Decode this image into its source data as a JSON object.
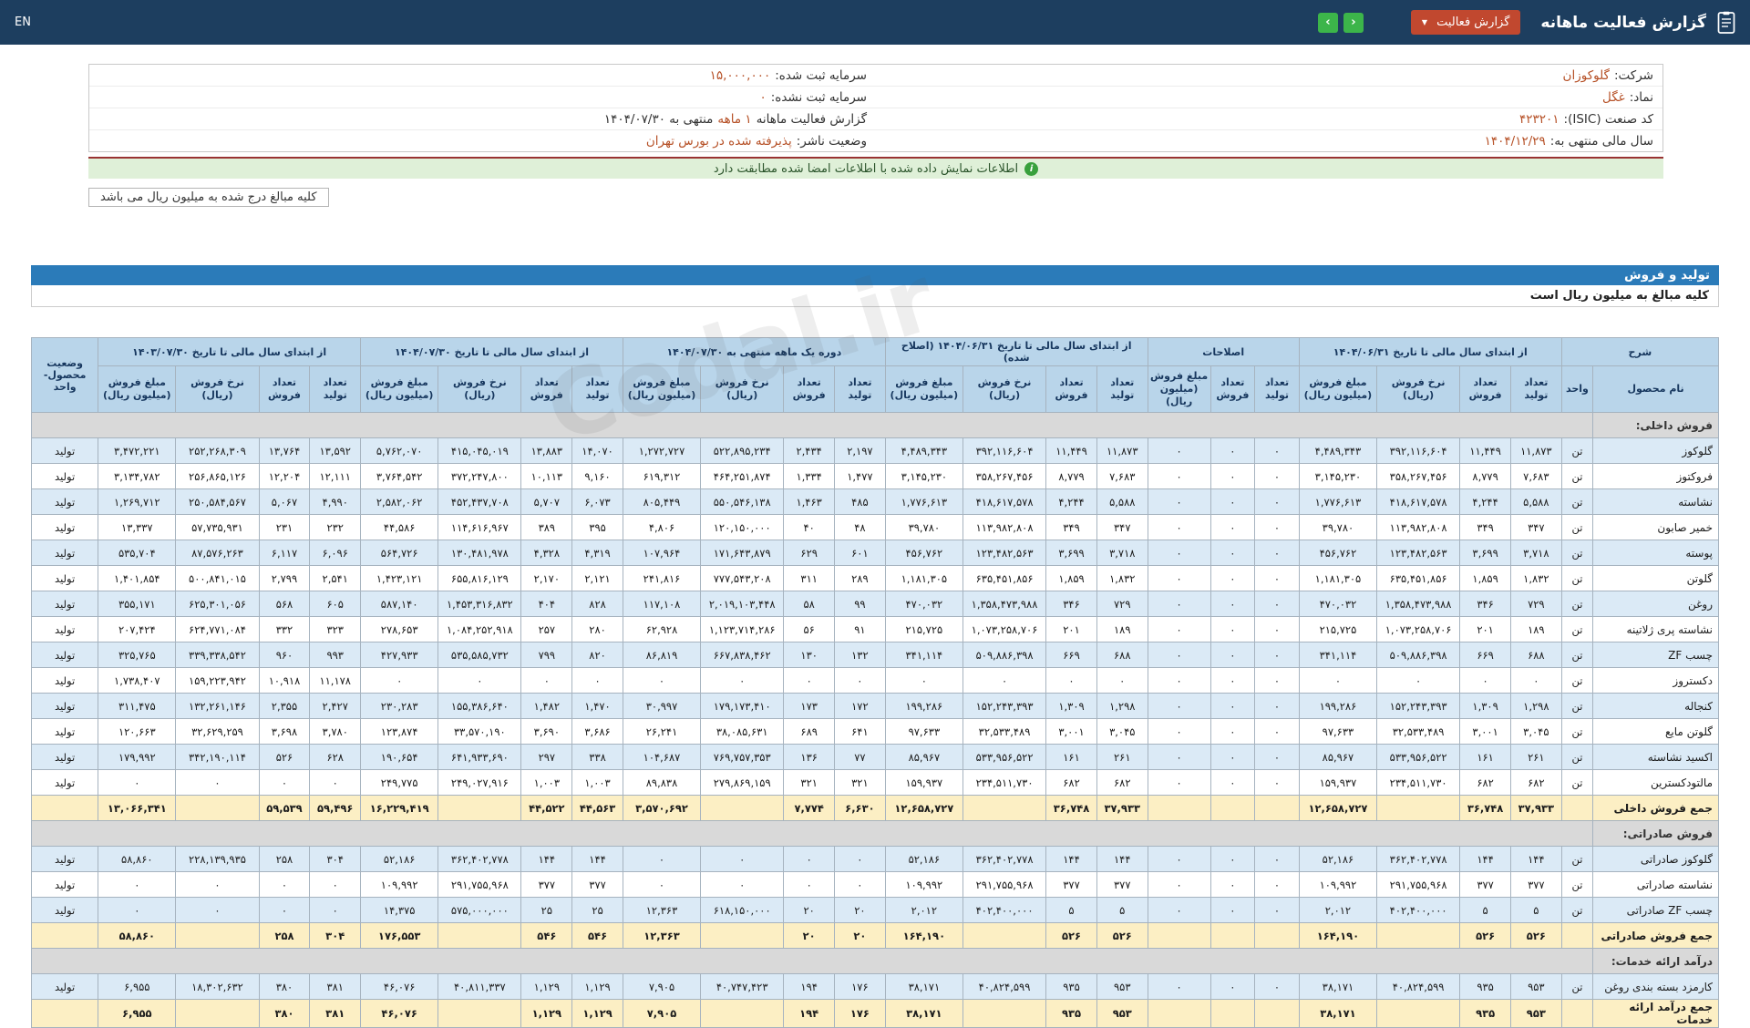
{
  "topbar": {
    "title": "گزارش فعالیت ماهانه",
    "dropdown_label": "گزارش فعالیت",
    "prev_glyph": "‹",
    "next_glyph": "›",
    "en_label": "EN"
  },
  "info": {
    "right_rows": [
      {
        "label": "شرکت:",
        "value": "گلوکوزان",
        "link": true
      },
      {
        "label": "نماد:",
        "value": "غگل",
        "link": true
      },
      {
        "label": "کد صنعت (ISIC):",
        "value": "۴۲۳۲۰۱",
        "link": false
      },
      {
        "label": "سال مالی منتهی به:",
        "value": "۱۴۰۴/۱۲/۲۹",
        "link": false
      }
    ],
    "left_rows": [
      {
        "label": "سرمایه ثبت شده:",
        "value": "۱۵,۰۰۰,۰۰۰",
        "link": false
      },
      {
        "label": "سرمایه ثبت نشده:",
        "value": "۰",
        "link": false
      },
      {
        "label": "گزارش فعالیت ماهانه",
        "value": "۱ ماهه",
        "suffix": "منتهی به ۱۴۰۴/۰۷/۳۰",
        "link": false
      },
      {
        "label": "وضعیت ناشر:",
        "value": "پذیرفته شده در بورس تهران",
        "link": false
      }
    ]
  },
  "banner": {
    "text": "اطلاعات نمایش داده شده با اطلاعات امضا شده مطابقت دارد"
  },
  "notes": {
    "pill": "کلیه مبالغ درج شده به میلیون ریال می باشد"
  },
  "section": {
    "title": "تولید و فروش",
    "subtitle": "کلیه مبالغ به میلیون ریال است"
  },
  "watermark": "Codal.ir",
  "colors": {
    "topbar": "#1d3e5f",
    "dropdown": "#c1482f",
    "nav_button": "#3cb54a",
    "link": "#b65127",
    "banner_bg": "#dff0d8",
    "section_bar": "#2b7bb9",
    "header_cell": "#b9d5ea",
    "row_alt": "#dbeaf6",
    "sum_row": "#fcefc4",
    "section_row": "#d9d9d9"
  },
  "table": {
    "desc_header": "شرح",
    "name_header": "نام محصول",
    "unit_header": "واحد",
    "status_header": "وضعیت محصول-واحد",
    "sub_headers": {
      "qty_prod": "تعداد تولید",
      "qty_sold": "تعداد فروش",
      "rate": "نرخ فروش (ریال)",
      "amount": "مبلغ فروش (میلیون ریال)"
    },
    "groups": [
      {
        "key": "g1",
        "label": "از ابتدای سال مالی تا تاریخ ۱۴۰۴/۰۶/۳۱",
        "cols": [
          "qty_prod",
          "qty_sold",
          "rate",
          "amount"
        ]
      },
      {
        "key": "g2",
        "label": "اصلاحات",
        "cols": [
          "qty_prod",
          "qty_sold",
          "amount"
        ]
      },
      {
        "key": "g3",
        "label": "از ابتدای سال مالی تا تاریخ ۱۴۰۴/۰۶/۳۱ (اصلاح شده)",
        "cols": [
          "qty_prod",
          "qty_sold",
          "rate",
          "amount"
        ]
      },
      {
        "key": "g4",
        "label": "دوره یک ماهه منتهی به ۱۴۰۴/۰۷/۳۰",
        "cols": [
          "qty_prod",
          "qty_sold",
          "rate",
          "amount"
        ]
      },
      {
        "key": "g5",
        "label": "از ابتدای سال مالی تا تاریخ ۱۴۰۴/۰۷/۳۰",
        "cols": [
          "qty_prod",
          "qty_sold",
          "rate",
          "amount"
        ]
      },
      {
        "key": "g6",
        "label": "از ابتدای سال مالی تا تاریخ ۱۴۰۳/۰۷/۳۰",
        "cols": [
          "qty_prod",
          "qty_sold",
          "rate",
          "amount"
        ]
      }
    ],
    "rows": [
      {
        "type": "section",
        "name": "فروش داخلی:"
      },
      {
        "type": "product",
        "name": "گلوکوز",
        "unit": "تن",
        "g1": [
          "۱۱,۸۷۳",
          "۱۱,۴۴۹",
          "۳۹۲,۱۱۶,۶۰۴",
          "۴,۴۸۹,۳۴۳"
        ],
        "g2": [
          "۰",
          "۰",
          "۰"
        ],
        "g3": [
          "۱۱,۸۷۳",
          "۱۱,۴۴۹",
          "۳۹۲,۱۱۶,۶۰۴",
          "۴,۴۸۹,۳۴۳"
        ],
        "g4": [
          "۲,۱۹۷",
          "۲,۴۳۴",
          "۵۲۲,۸۹۵,۲۳۴",
          "۱,۲۷۲,۷۲۷"
        ],
        "g5": [
          "۱۴,۰۷۰",
          "۱۳,۸۸۳",
          "۴۱۵,۰۴۵,۰۱۹",
          "۵,۷۶۲,۰۷۰"
        ],
        "g6": [
          "۱۳,۵۹۲",
          "۱۳,۷۶۴",
          "۲۵۲,۲۶۸,۳۰۹",
          "۳,۴۷۲,۲۲۱"
        ],
        "status": "تولید"
      },
      {
        "type": "product",
        "name": "فروکتوز",
        "unit": "تن",
        "g1": [
          "۷,۶۸۳",
          "۸,۷۷۹",
          "۳۵۸,۲۶۷,۴۵۶",
          "۳,۱۴۵,۲۳۰"
        ],
        "g2": [
          "۰",
          "۰",
          "۰"
        ],
        "g3": [
          "۷,۶۸۳",
          "۸,۷۷۹",
          "۳۵۸,۲۶۷,۴۵۶",
          "۳,۱۴۵,۲۳۰"
        ],
        "g4": [
          "۱,۴۷۷",
          "۱,۳۳۴",
          "۴۶۴,۲۵۱,۸۷۴",
          "۶۱۹,۳۱۲"
        ],
        "g5": [
          "۹,۱۶۰",
          "۱۰,۱۱۳",
          "۳۷۲,۲۴۷,۸۰۰",
          "۳,۷۶۴,۵۴۲"
        ],
        "g6": [
          "۱۲,۱۱۱",
          "۱۲,۲۰۴",
          "۲۵۶,۸۶۵,۱۲۶",
          "۳,۱۳۴,۷۸۲"
        ],
        "status": "تولید"
      },
      {
        "type": "product",
        "name": "نشاسته",
        "unit": "تن",
        "g1": [
          "۵,۵۸۸",
          "۴,۲۴۴",
          "۴۱۸,۶۱۷,۵۷۸",
          "۱,۷۷۶,۶۱۳"
        ],
        "g2": [
          "۰",
          "۰",
          "۰"
        ],
        "g3": [
          "۵,۵۸۸",
          "۴,۲۴۴",
          "۴۱۸,۶۱۷,۵۷۸",
          "۱,۷۷۶,۶۱۳"
        ],
        "g4": [
          "۴۸۵",
          "۱,۴۶۳",
          "۵۵۰,۵۴۶,۱۳۸",
          "۸۰۵,۴۴۹"
        ],
        "g5": [
          "۶,۰۷۳",
          "۵,۷۰۷",
          "۴۵۲,۴۳۷,۷۰۸",
          "۲,۵۸۲,۰۶۲"
        ],
        "g6": [
          "۴,۹۹۰",
          "۵,۰۶۷",
          "۲۵۰,۵۸۴,۵۶۷",
          "۱,۲۶۹,۷۱۲"
        ],
        "status": "تولید"
      },
      {
        "type": "product",
        "name": "خمیر صابون",
        "unit": "تن",
        "g1": [
          "۳۴۷",
          "۳۴۹",
          "۱۱۳,۹۸۲,۸۰۸",
          "۳۹,۷۸۰"
        ],
        "g2": [
          "۰",
          "۰",
          "۰"
        ],
        "g3": [
          "۳۴۷",
          "۳۴۹",
          "۱۱۳,۹۸۲,۸۰۸",
          "۳۹,۷۸۰"
        ],
        "g4": [
          "۴۸",
          "۴۰",
          "۱۲۰,۱۵۰,۰۰۰",
          "۴,۸۰۶"
        ],
        "g5": [
          "۳۹۵",
          "۳۸۹",
          "۱۱۴,۶۱۶,۹۶۷",
          "۴۴,۵۸۶"
        ],
        "g6": [
          "۲۳۲",
          "۲۳۱",
          "۵۷,۷۳۵,۹۳۱",
          "۱۳,۳۳۷"
        ],
        "status": "تولید"
      },
      {
        "type": "product",
        "name": "پوسته",
        "unit": "تن",
        "g1": [
          "۳,۷۱۸",
          "۳,۶۹۹",
          "۱۲۳,۴۸۲,۵۶۳",
          "۴۵۶,۷۶۲"
        ],
        "g2": [
          "۰",
          "۰",
          "۰"
        ],
        "g3": [
          "۳,۷۱۸",
          "۳,۶۹۹",
          "۱۲۳,۴۸۲,۵۶۳",
          "۴۵۶,۷۶۲"
        ],
        "g4": [
          "۶۰۱",
          "۶۲۹",
          "۱۷۱,۶۴۳,۸۷۹",
          "۱۰۷,۹۶۴"
        ],
        "g5": [
          "۴,۳۱۹",
          "۴,۳۲۸",
          "۱۳۰,۴۸۱,۹۷۸",
          "۵۶۴,۷۲۶"
        ],
        "g6": [
          "۶,۰۹۶",
          "۶,۱۱۷",
          "۸۷,۵۷۶,۲۶۳",
          "۵۳۵,۷۰۴"
        ],
        "status": "تولید"
      },
      {
        "type": "product",
        "name": "گلوتن",
        "unit": "تن",
        "g1": [
          "۱,۸۳۲",
          "۱,۸۵۹",
          "۶۳۵,۴۵۱,۸۵۶",
          "۱,۱۸۱,۳۰۵"
        ],
        "g2": [
          "۰",
          "۰",
          "۰"
        ],
        "g3": [
          "۱,۸۳۲",
          "۱,۸۵۹",
          "۶۳۵,۴۵۱,۸۵۶",
          "۱,۱۸۱,۳۰۵"
        ],
        "g4": [
          "۲۸۹",
          "۳۱۱",
          "۷۷۷,۵۴۳,۲۰۸",
          "۲۴۱,۸۱۶"
        ],
        "g5": [
          "۲,۱۲۱",
          "۲,۱۷۰",
          "۶۵۵,۸۱۶,۱۲۹",
          "۱,۴۲۳,۱۲۱"
        ],
        "g6": [
          "۲,۵۴۱",
          "۲,۷۹۹",
          "۵۰۰,۸۴۱,۰۱۵",
          "۱,۴۰۱,۸۵۴"
        ],
        "status": "تولید"
      },
      {
        "type": "product",
        "name": "روغن",
        "unit": "تن",
        "g1": [
          "۷۲۹",
          "۳۴۶",
          "۱,۳۵۸,۴۷۳,۹۸۸",
          "۴۷۰,۰۳۲"
        ],
        "g2": [
          "۰",
          "۰",
          "۰"
        ],
        "g3": [
          "۷۲۹",
          "۳۴۶",
          "۱,۳۵۸,۴۷۳,۹۸۸",
          "۴۷۰,۰۳۲"
        ],
        "g4": [
          "۹۹",
          "۵۸",
          "۲,۰۱۹,۱۰۳,۴۴۸",
          "۱۱۷,۱۰۸"
        ],
        "g5": [
          "۸۲۸",
          "۴۰۴",
          "۱,۴۵۳,۳۱۶,۸۳۲",
          "۵۸۷,۱۴۰"
        ],
        "g6": [
          "۶۰۵",
          "۵۶۸",
          "۶۲۵,۳۰۱,۰۵۶",
          "۳۵۵,۱۷۱"
        ],
        "status": "تولید"
      },
      {
        "type": "product",
        "name": "نشاسته پری ژلاتینه",
        "unit": "تن",
        "g1": [
          "۱۸۹",
          "۲۰۱",
          "۱,۰۷۳,۲۵۸,۷۰۶",
          "۲۱۵,۷۲۵"
        ],
        "g2": [
          "۰",
          "۰",
          "۰"
        ],
        "g3": [
          "۱۸۹",
          "۲۰۱",
          "۱,۰۷۳,۲۵۸,۷۰۶",
          "۲۱۵,۷۲۵"
        ],
        "g4": [
          "۹۱",
          "۵۶",
          "۱,۱۲۳,۷۱۴,۲۸۶",
          "۶۲,۹۲۸"
        ],
        "g5": [
          "۲۸۰",
          "۲۵۷",
          "۱,۰۸۴,۲۵۲,۹۱۸",
          "۲۷۸,۶۵۳"
        ],
        "g6": [
          "۳۲۳",
          "۳۳۲",
          "۶۲۴,۷۷۱,۰۸۴",
          "۲۰۷,۴۲۴"
        ],
        "status": "تولید"
      },
      {
        "type": "product",
        "name": "چسب ZF",
        "unit": "تن",
        "g1": [
          "۶۸۸",
          "۶۶۹",
          "۵۰۹,۸۸۶,۳۹۸",
          "۳۴۱,۱۱۴"
        ],
        "g2": [
          "۰",
          "۰",
          "۰"
        ],
        "g3": [
          "۶۸۸",
          "۶۶۹",
          "۵۰۹,۸۸۶,۳۹۸",
          "۳۴۱,۱۱۴"
        ],
        "g4": [
          "۱۳۲",
          "۱۳۰",
          "۶۶۷,۸۳۸,۴۶۲",
          "۸۶,۸۱۹"
        ],
        "g5": [
          "۸۲۰",
          "۷۹۹",
          "۵۳۵,۵۸۵,۷۳۲",
          "۴۲۷,۹۳۳"
        ],
        "g6": [
          "۹۹۳",
          "۹۶۰",
          "۳۳۹,۳۳۸,۵۴۲",
          "۳۲۵,۷۶۵"
        ],
        "status": "تولید"
      },
      {
        "type": "product",
        "name": "دکستروز",
        "unit": "تن",
        "g1": [
          "۰",
          "۰",
          "۰",
          "۰"
        ],
        "g2": [
          "۰",
          "۰",
          "۰"
        ],
        "g3": [
          "۰",
          "۰",
          "۰",
          "۰"
        ],
        "g4": [
          "۰",
          "۰",
          "۰",
          "۰"
        ],
        "g5": [
          "۰",
          "۰",
          "۰",
          "۰"
        ],
        "g6": [
          "۱۱,۱۷۸",
          "۱۰,۹۱۸",
          "۱۵۹,۲۲۳,۹۴۲",
          "۱,۷۳۸,۴۰۷"
        ],
        "status": "تولید"
      },
      {
        "type": "product",
        "name": "کنجاله",
        "unit": "تن",
        "g1": [
          "۱,۲۹۸",
          "۱,۳۰۹",
          "۱۵۲,۲۴۳,۳۹۳",
          "۱۹۹,۲۸۶"
        ],
        "g2": [
          "۰",
          "۰",
          "۰"
        ],
        "g3": [
          "۱,۲۹۸",
          "۱,۳۰۹",
          "۱۵۲,۲۴۳,۳۹۳",
          "۱۹۹,۲۸۶"
        ],
        "g4": [
          "۱۷۲",
          "۱۷۳",
          "۱۷۹,۱۷۳,۴۱۰",
          "۳۰,۹۹۷"
        ],
        "g5": [
          "۱,۴۷۰",
          "۱,۴۸۲",
          "۱۵۵,۳۸۶,۶۴۰",
          "۲۳۰,۲۸۳"
        ],
        "g6": [
          "۲,۴۲۷",
          "۲,۳۵۵",
          "۱۳۲,۲۶۱,۱۴۶",
          "۳۱۱,۴۷۵"
        ],
        "status": "تولید"
      },
      {
        "type": "product",
        "name": "گلوتن مایع",
        "unit": "تن",
        "g1": [
          "۳,۰۴۵",
          "۳,۰۰۱",
          "۳۲,۵۳۳,۴۸۹",
          "۹۷,۶۳۳"
        ],
        "g2": [
          "۰",
          "۰",
          "۰"
        ],
        "g3": [
          "۳,۰۴۵",
          "۳,۰۰۱",
          "۳۲,۵۳۳,۴۸۹",
          "۹۷,۶۳۳"
        ],
        "g4": [
          "۶۴۱",
          "۶۸۹",
          "۳۸,۰۸۵,۶۳۱",
          "۲۶,۲۴۱"
        ],
        "g5": [
          "۳,۶۸۶",
          "۳,۶۹۰",
          "۳۳,۵۷۰,۱۹۰",
          "۱۲۳,۸۷۴"
        ],
        "g6": [
          "۳,۷۸۰",
          "۳,۶۹۸",
          "۳۲,۶۲۹,۲۵۹",
          "۱۲۰,۶۶۳"
        ],
        "status": "تولید"
      },
      {
        "type": "product",
        "name": "اکسید نشاسته",
        "unit": "تن",
        "g1": [
          "۲۶۱",
          "۱۶۱",
          "۵۳۳,۹۵۶,۵۲۲",
          "۸۵,۹۶۷"
        ],
        "g2": [
          "۰",
          "۰",
          "۰"
        ],
        "g3": [
          "۲۶۱",
          "۱۶۱",
          "۵۳۳,۹۵۶,۵۲۲",
          "۸۵,۹۶۷"
        ],
        "g4": [
          "۷۷",
          "۱۳۶",
          "۷۶۹,۷۵۷,۳۵۳",
          "۱۰۴,۶۸۷"
        ],
        "g5": [
          "۳۳۸",
          "۲۹۷",
          "۶۴۱,۹۳۳,۶۹۰",
          "۱۹۰,۶۵۴"
        ],
        "g6": [
          "۶۲۸",
          "۵۲۶",
          "۳۴۲,۱۹۰,۱۱۴",
          "۱۷۹,۹۹۲"
        ],
        "status": "تولید"
      },
      {
        "type": "product",
        "name": "مالتودکسترین",
        "unit": "تن",
        "g1": [
          "۶۸۲",
          "۶۸۲",
          "۲۳۴,۵۱۱,۷۳۰",
          "۱۵۹,۹۳۷"
        ],
        "g2": [
          "۰",
          "۰",
          "۰"
        ],
        "g3": [
          "۶۸۲",
          "۶۸۲",
          "۲۳۴,۵۱۱,۷۳۰",
          "۱۵۹,۹۳۷"
        ],
        "g4": [
          "۳۲۱",
          "۳۲۱",
          "۲۷۹,۸۶۹,۱۵۹",
          "۸۹,۸۳۸"
        ],
        "g5": [
          "۱,۰۰۳",
          "۱,۰۰۳",
          "۲۴۹,۰۲۷,۹۱۶",
          "۲۴۹,۷۷۵"
        ],
        "g6": [
          "۰",
          "۰",
          "۰",
          "۰"
        ],
        "status": "تولید"
      },
      {
        "type": "sum",
        "name": "جمع فروش داخلی",
        "unit": "",
        "g1": [
          "۳۷,۹۳۳",
          "۳۶,۷۴۸",
          "",
          "۱۲,۶۵۸,۷۲۷"
        ],
        "g2": [
          "",
          "",
          ""
        ],
        "g3": [
          "۳۷,۹۳۳",
          "۳۶,۷۴۸",
          "",
          "۱۲,۶۵۸,۷۲۷"
        ],
        "g4": [
          "۶,۶۳۰",
          "۷,۷۷۴",
          "",
          "۳,۵۷۰,۶۹۲"
        ],
        "g5": [
          "۴۴,۵۶۳",
          "۴۴,۵۲۲",
          "",
          "۱۶,۲۲۹,۴۱۹"
        ],
        "g6": [
          "۵۹,۴۹۶",
          "۵۹,۵۳۹",
          "",
          "۱۳,۰۶۶,۳۴۱"
        ],
        "status": ""
      },
      {
        "type": "section",
        "name": "فروش صادراتی:"
      },
      {
        "type": "product",
        "name": "گلوکوز صادراتی",
        "unit": "تن",
        "g1": [
          "۱۴۴",
          "۱۴۴",
          "۳۶۲,۴۰۲,۷۷۸",
          "۵۲,۱۸۶"
        ],
        "g2": [
          "۰",
          "۰",
          "۰"
        ],
        "g3": [
          "۱۴۴",
          "۱۴۴",
          "۳۶۲,۴۰۲,۷۷۸",
          "۵۲,۱۸۶"
        ],
        "g4": [
          "۰",
          "۰",
          "۰",
          "۰"
        ],
        "g5": [
          "۱۴۴",
          "۱۴۴",
          "۳۶۲,۴۰۲,۷۷۸",
          "۵۲,۱۸۶"
        ],
        "g6": [
          "۳۰۴",
          "۲۵۸",
          "۲۲۸,۱۳۹,۹۳۵",
          "۵۸,۸۶۰"
        ],
        "status": "تولید"
      },
      {
        "type": "product",
        "name": "نشاسته صادراتی",
        "unit": "تن",
        "g1": [
          "۳۷۷",
          "۳۷۷",
          "۲۹۱,۷۵۵,۹۶۸",
          "۱۰۹,۹۹۲"
        ],
        "g2": [
          "۰",
          "۰",
          "۰"
        ],
        "g3": [
          "۳۷۷",
          "۳۷۷",
          "۲۹۱,۷۵۵,۹۶۸",
          "۱۰۹,۹۹۲"
        ],
        "g4": [
          "۰",
          "۰",
          "۰",
          "۰"
        ],
        "g5": [
          "۳۷۷",
          "۳۷۷",
          "۲۹۱,۷۵۵,۹۶۸",
          "۱۰۹,۹۹۲"
        ],
        "g6": [
          "۰",
          "۰",
          "۰",
          "۰"
        ],
        "status": "تولید"
      },
      {
        "type": "product",
        "name": "چسب ZF صادراتی",
        "unit": "تن",
        "g1": [
          "۵",
          "۵",
          "۴۰۲,۴۰۰,۰۰۰",
          "۲,۰۱۲"
        ],
        "g2": [
          "۰",
          "۰",
          "۰"
        ],
        "g3": [
          "۵",
          "۵",
          "۴۰۲,۴۰۰,۰۰۰",
          "۲,۰۱۲"
        ],
        "g4": [
          "۲۰",
          "۲۰",
          "۶۱۸,۱۵۰,۰۰۰",
          "۱۲,۳۶۳"
        ],
        "g5": [
          "۲۵",
          "۲۵",
          "۵۷۵,۰۰۰,۰۰۰",
          "۱۴,۳۷۵"
        ],
        "g6": [
          "۰",
          "۰",
          "۰",
          "۰"
        ],
        "status": "تولید"
      },
      {
        "type": "sum",
        "name": "جمع فروش صادراتی",
        "unit": "",
        "g1": [
          "۵۲۶",
          "۵۲۶",
          "",
          "۱۶۴,۱۹۰"
        ],
        "g2": [
          "",
          "",
          ""
        ],
        "g3": [
          "۵۲۶",
          "۵۲۶",
          "",
          "۱۶۴,۱۹۰"
        ],
        "g4": [
          "۲۰",
          "۲۰",
          "",
          "۱۲,۳۶۳"
        ],
        "g5": [
          "۵۴۶",
          "۵۴۶",
          "",
          "۱۷۶,۵۵۳"
        ],
        "g6": [
          "۳۰۴",
          "۲۵۸",
          "",
          "۵۸,۸۶۰"
        ],
        "status": ""
      },
      {
        "type": "section",
        "name": "درآمد ارائه خدمات:"
      },
      {
        "type": "product",
        "name": "کارمزد بسته بندی روغن",
        "unit": "تن",
        "g1": [
          "۹۵۳",
          "۹۳۵",
          "۴۰,۸۲۴,۵۹۹",
          "۳۸,۱۷۱"
        ],
        "g2": [
          "۰",
          "۰",
          "۰"
        ],
        "g3": [
          "۹۵۳",
          "۹۳۵",
          "۴۰,۸۲۴,۵۹۹",
          "۳۸,۱۷۱"
        ],
        "g4": [
          "۱۷۶",
          "۱۹۴",
          "۴۰,۷۴۷,۴۲۳",
          "۷,۹۰۵"
        ],
        "g5": [
          "۱,۱۲۹",
          "۱,۱۲۹",
          "۴۰,۸۱۱,۳۳۷",
          "۴۶,۰۷۶"
        ],
        "g6": [
          "۳۸۱",
          "۳۸۰",
          "۱۸,۳۰۲,۶۳۲",
          "۶,۹۵۵"
        ],
        "status": "تولید"
      },
      {
        "type": "sum",
        "name": "جمع درآمد ارائه خدمات",
        "unit": "",
        "g1": [
          "۹۵۳",
          "۹۳۵",
          "",
          "۳۸,۱۷۱"
        ],
        "g2": [
          "",
          "",
          ""
        ],
        "g3": [
          "۹۵۳",
          "۹۳۵",
          "",
          "۳۸,۱۷۱"
        ],
        "g4": [
          "۱۷۶",
          "۱۹۴",
          "",
          "۷,۹۰۵"
        ],
        "g5": [
          "۱,۱۲۹",
          "۱,۱۲۹",
          "",
          "۴۶,۰۷۶"
        ],
        "g6": [
          "۳۸۱",
          "۳۸۰",
          "",
          "۶,۹۵۵"
        ],
        "status": ""
      }
    ]
  }
}
